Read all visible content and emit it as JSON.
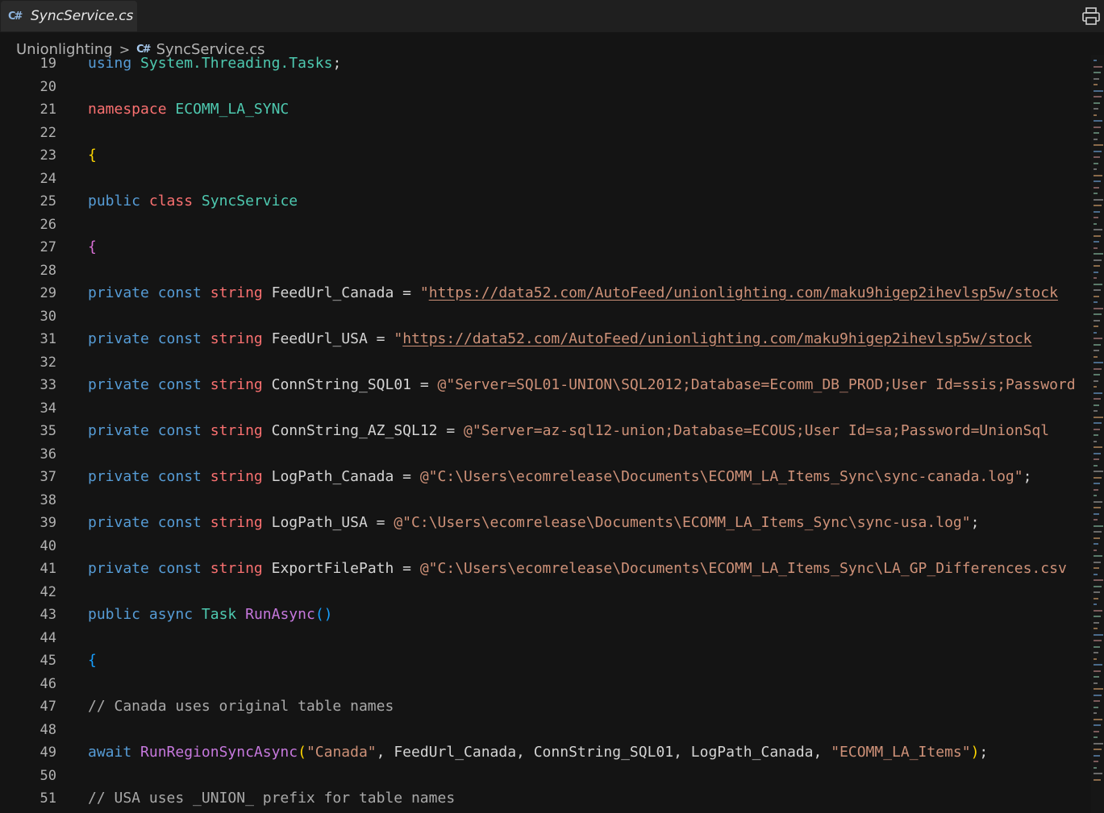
{
  "tab": {
    "icon": "C#",
    "label": "SyncService.cs"
  },
  "toolbar": {
    "print_icon": "printer-icon"
  },
  "breadcrumb": {
    "root": "Unionlighting",
    "sep": ">",
    "file_icon": "C#",
    "file": "SyncService.cs"
  },
  "colors": {
    "background": "#141414",
    "keyword": "#569cd6",
    "keyword_red": "#f97070",
    "type": "#4ec9b0",
    "string": "#ce9178",
    "comment": "#a9a9a9",
    "method": "#c678dd"
  },
  "lines": [
    {
      "n": "19",
      "tokens": [
        {
          "c": "t-kw",
          "t": "using"
        },
        {
          "c": "t-pl",
          "t": " "
        },
        {
          "c": "t-ty",
          "t": "System.Threading.Tasks"
        },
        {
          "c": "t-pl",
          "t": ";"
        }
      ]
    },
    {
      "n": "20",
      "tokens": []
    },
    {
      "n": "21",
      "tokens": [
        {
          "c": "t-kw2",
          "t": "namespace"
        },
        {
          "c": "t-pl",
          "t": " "
        },
        {
          "c": "t-ty",
          "t": "ECOMM_LA_SYNC"
        }
      ]
    },
    {
      "n": "22",
      "tokens": []
    },
    {
      "n": "23",
      "tokens": [
        {
          "c": "t-br1",
          "t": "{"
        }
      ]
    },
    {
      "n": "24",
      "tokens": []
    },
    {
      "n": "25",
      "tokens": [
        {
          "c": "t-kw",
          "t": "public"
        },
        {
          "c": "t-pl",
          "t": " "
        },
        {
          "c": "t-kw2",
          "t": "class"
        },
        {
          "c": "t-pl",
          "t": " "
        },
        {
          "c": "t-ty",
          "t": "SyncService"
        }
      ]
    },
    {
      "n": "26",
      "tokens": []
    },
    {
      "n": "27",
      "tokens": [
        {
          "c": "t-br2",
          "t": "{"
        }
      ]
    },
    {
      "n": "28",
      "tokens": []
    },
    {
      "n": "29",
      "tokens": [
        {
          "c": "t-kw",
          "t": "private"
        },
        {
          "c": "t-pl",
          "t": " "
        },
        {
          "c": "t-kw",
          "t": "const"
        },
        {
          "c": "t-pl",
          "t": " "
        },
        {
          "c": "t-kw2",
          "t": "string"
        },
        {
          "c": "t-pl",
          "t": " "
        },
        {
          "c": "t-id",
          "t": "FeedUrl_Canada"
        },
        {
          "c": "t-pl",
          "t": " = "
        },
        {
          "c": "t-str",
          "t": "\""
        },
        {
          "c": "t-url",
          "t": "https://data52.com/AutoFeed/unionlighting.com/maku9higep2ihevlsp5w/stock"
        }
      ]
    },
    {
      "n": "30",
      "tokens": []
    },
    {
      "n": "31",
      "tokens": [
        {
          "c": "t-kw",
          "t": "private"
        },
        {
          "c": "t-pl",
          "t": " "
        },
        {
          "c": "t-kw",
          "t": "const"
        },
        {
          "c": "t-pl",
          "t": " "
        },
        {
          "c": "t-kw2",
          "t": "string"
        },
        {
          "c": "t-pl",
          "t": " "
        },
        {
          "c": "t-id",
          "t": "FeedUrl_USA"
        },
        {
          "c": "t-pl",
          "t": " = "
        },
        {
          "c": "t-str",
          "t": "\""
        },
        {
          "c": "t-url",
          "t": "https://data52.com/AutoFeed/unionlighting.com/maku9higep2ihevlsp5w/stock"
        }
      ]
    },
    {
      "n": "32",
      "tokens": []
    },
    {
      "n": "33",
      "tokens": [
        {
          "c": "t-kw",
          "t": "private"
        },
        {
          "c": "t-pl",
          "t": " "
        },
        {
          "c": "t-kw",
          "t": "const"
        },
        {
          "c": "t-pl",
          "t": " "
        },
        {
          "c": "t-kw2",
          "t": "string"
        },
        {
          "c": "t-pl",
          "t": " "
        },
        {
          "c": "t-id",
          "t": "ConnString_SQL01"
        },
        {
          "c": "t-pl",
          "t": " = "
        },
        {
          "c": "t-str",
          "t": "@\"Server=SQL01-UNION\\SQL2012;Database=Ecomm_DB_PROD;User Id=ssis;Password"
        }
      ]
    },
    {
      "n": "34",
      "tokens": []
    },
    {
      "n": "35",
      "tokens": [
        {
          "c": "t-kw",
          "t": "private"
        },
        {
          "c": "t-pl",
          "t": " "
        },
        {
          "c": "t-kw",
          "t": "const"
        },
        {
          "c": "t-pl",
          "t": " "
        },
        {
          "c": "t-kw2",
          "t": "string"
        },
        {
          "c": "t-pl",
          "t": " "
        },
        {
          "c": "t-id",
          "t": "ConnString_AZ_SQL12"
        },
        {
          "c": "t-pl",
          "t": " = "
        },
        {
          "c": "t-str",
          "t": "@\"Server=az-sql12-union;Database=ECOUS;User Id=sa;Password=UnionSql"
        }
      ]
    },
    {
      "n": "36",
      "tokens": []
    },
    {
      "n": "37",
      "tokens": [
        {
          "c": "t-kw",
          "t": "private"
        },
        {
          "c": "t-pl",
          "t": " "
        },
        {
          "c": "t-kw",
          "t": "const"
        },
        {
          "c": "t-pl",
          "t": " "
        },
        {
          "c": "t-kw2",
          "t": "string"
        },
        {
          "c": "t-pl",
          "t": " "
        },
        {
          "c": "t-id",
          "t": "LogPath_Canada"
        },
        {
          "c": "t-pl",
          "t": " = "
        },
        {
          "c": "t-str",
          "t": "@\"C:\\Users\\ecomrelease\\Documents\\ECOMM_LA_Items_Sync\\sync-canada.log\""
        },
        {
          "c": "t-pl",
          "t": ";"
        }
      ]
    },
    {
      "n": "38",
      "tokens": []
    },
    {
      "n": "39",
      "tokens": [
        {
          "c": "t-kw",
          "t": "private"
        },
        {
          "c": "t-pl",
          "t": " "
        },
        {
          "c": "t-kw",
          "t": "const"
        },
        {
          "c": "t-pl",
          "t": " "
        },
        {
          "c": "t-kw2",
          "t": "string"
        },
        {
          "c": "t-pl",
          "t": " "
        },
        {
          "c": "t-id",
          "t": "LogPath_USA"
        },
        {
          "c": "t-pl",
          "t": " = "
        },
        {
          "c": "t-str",
          "t": "@\"C:\\Users\\ecomrelease\\Documents\\ECOMM_LA_Items_Sync\\sync-usa.log\""
        },
        {
          "c": "t-pl",
          "t": ";"
        }
      ]
    },
    {
      "n": "40",
      "tokens": []
    },
    {
      "n": "41",
      "tokens": [
        {
          "c": "t-kw",
          "t": "private"
        },
        {
          "c": "t-pl",
          "t": " "
        },
        {
          "c": "t-kw",
          "t": "const"
        },
        {
          "c": "t-pl",
          "t": " "
        },
        {
          "c": "t-kw2",
          "t": "string"
        },
        {
          "c": "t-pl",
          "t": " "
        },
        {
          "c": "t-id",
          "t": "ExportFilePath"
        },
        {
          "c": "t-pl",
          "t": " = "
        },
        {
          "c": "t-str",
          "t": "@\"C:\\Users\\ecomrelease\\Documents\\ECOMM_LA_Items_Sync\\LA_GP_Differences.csv"
        }
      ]
    },
    {
      "n": "42",
      "tokens": []
    },
    {
      "n": "43",
      "tokens": [
        {
          "c": "t-kw",
          "t": "public"
        },
        {
          "c": "t-pl",
          "t": " "
        },
        {
          "c": "t-kw",
          "t": "async"
        },
        {
          "c": "t-pl",
          "t": " "
        },
        {
          "c": "t-ty",
          "t": "Task"
        },
        {
          "c": "t-pl",
          "t": " "
        },
        {
          "c": "t-fn",
          "t": "RunAsync"
        },
        {
          "c": "t-br3",
          "t": "()"
        }
      ]
    },
    {
      "n": "44",
      "tokens": []
    },
    {
      "n": "45",
      "tokens": [
        {
          "c": "t-br3",
          "t": "{"
        }
      ]
    },
    {
      "n": "46",
      "tokens": []
    },
    {
      "n": "47",
      "tokens": [
        {
          "c": "t-com",
          "t": "// Canada uses original table names"
        }
      ]
    },
    {
      "n": "48",
      "tokens": []
    },
    {
      "n": "49",
      "tokens": [
        {
          "c": "t-kw",
          "t": "await"
        },
        {
          "c": "t-pl",
          "t": " "
        },
        {
          "c": "t-fn",
          "t": "RunRegionSyncAsync"
        },
        {
          "c": "t-br1",
          "t": "("
        },
        {
          "c": "t-str",
          "t": "\"Canada\""
        },
        {
          "c": "t-pl",
          "t": ", FeedUrl_Canada, ConnString_SQL01, LogPath_Canada, "
        },
        {
          "c": "t-str",
          "t": "\"ECOMM_LA_Items\""
        },
        {
          "c": "t-br1",
          "t": ")"
        },
        {
          "c": "t-pl",
          "t": ";"
        }
      ]
    },
    {
      "n": "50",
      "tokens": []
    },
    {
      "n": "51",
      "tokens": [
        {
          "c": "t-com",
          "t": "// USA uses _UNION_ prefix for table names"
        }
      ]
    }
  ]
}
